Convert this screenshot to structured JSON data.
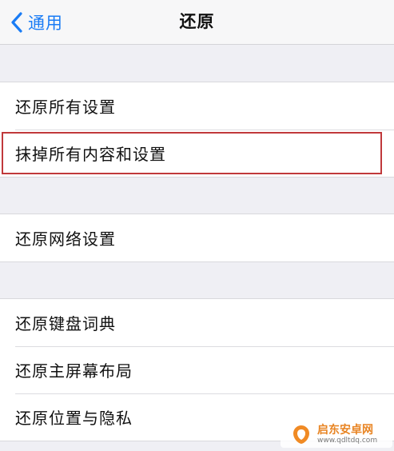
{
  "nav": {
    "back_label": "通用",
    "title": "还原"
  },
  "groups": [
    {
      "items": [
        {
          "label": "还原所有设置"
        },
        {
          "label": "抹掉所有内容和设置"
        }
      ]
    },
    {
      "items": [
        {
          "label": "还原网络设置"
        }
      ]
    },
    {
      "items": [
        {
          "label": "还原键盘词典"
        },
        {
          "label": "还原主屏幕布局"
        },
        {
          "label": "还原位置与隐私"
        }
      ]
    }
  ],
  "highlighted_item": "抹掉所有内容和设置",
  "colors": {
    "accent": "#1a7cf5",
    "highlight_border": "#c0393b",
    "background": "#efeff4"
  },
  "watermark": {
    "name": "启东安卓网",
    "url": "www.qdltdq.com"
  }
}
